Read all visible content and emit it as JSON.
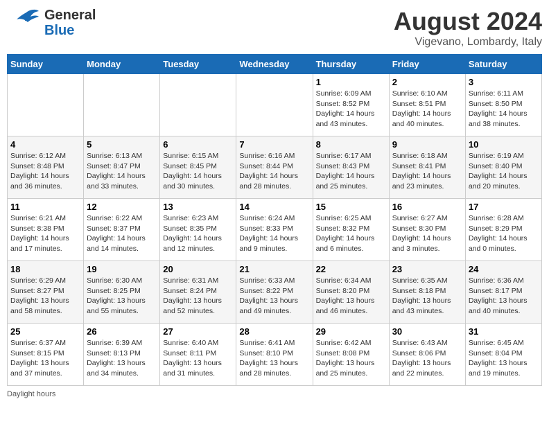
{
  "header": {
    "logo_general": "General",
    "logo_blue": "Blue",
    "month_year": "August 2024",
    "location": "Vigevano, Lombardy, Italy"
  },
  "days_of_week": [
    "Sunday",
    "Monday",
    "Tuesday",
    "Wednesday",
    "Thursday",
    "Friday",
    "Saturday"
  ],
  "weeks": [
    [
      {
        "day": "",
        "info": ""
      },
      {
        "day": "",
        "info": ""
      },
      {
        "day": "",
        "info": ""
      },
      {
        "day": "",
        "info": ""
      },
      {
        "day": "1",
        "info": "Sunrise: 6:09 AM\nSunset: 8:52 PM\nDaylight: 14 hours\nand 43 minutes."
      },
      {
        "day": "2",
        "info": "Sunrise: 6:10 AM\nSunset: 8:51 PM\nDaylight: 14 hours\nand 40 minutes."
      },
      {
        "day": "3",
        "info": "Sunrise: 6:11 AM\nSunset: 8:50 PM\nDaylight: 14 hours\nand 38 minutes."
      }
    ],
    [
      {
        "day": "4",
        "info": "Sunrise: 6:12 AM\nSunset: 8:48 PM\nDaylight: 14 hours\nand 36 minutes."
      },
      {
        "day": "5",
        "info": "Sunrise: 6:13 AM\nSunset: 8:47 PM\nDaylight: 14 hours\nand 33 minutes."
      },
      {
        "day": "6",
        "info": "Sunrise: 6:15 AM\nSunset: 8:45 PM\nDaylight: 14 hours\nand 30 minutes."
      },
      {
        "day": "7",
        "info": "Sunrise: 6:16 AM\nSunset: 8:44 PM\nDaylight: 14 hours\nand 28 minutes."
      },
      {
        "day": "8",
        "info": "Sunrise: 6:17 AM\nSunset: 8:43 PM\nDaylight: 14 hours\nand 25 minutes."
      },
      {
        "day": "9",
        "info": "Sunrise: 6:18 AM\nSunset: 8:41 PM\nDaylight: 14 hours\nand 23 minutes."
      },
      {
        "day": "10",
        "info": "Sunrise: 6:19 AM\nSunset: 8:40 PM\nDaylight: 14 hours\nand 20 minutes."
      }
    ],
    [
      {
        "day": "11",
        "info": "Sunrise: 6:21 AM\nSunset: 8:38 PM\nDaylight: 14 hours\nand 17 minutes."
      },
      {
        "day": "12",
        "info": "Sunrise: 6:22 AM\nSunset: 8:37 PM\nDaylight: 14 hours\nand 14 minutes."
      },
      {
        "day": "13",
        "info": "Sunrise: 6:23 AM\nSunset: 8:35 PM\nDaylight: 14 hours\nand 12 minutes."
      },
      {
        "day": "14",
        "info": "Sunrise: 6:24 AM\nSunset: 8:33 PM\nDaylight: 14 hours\nand 9 minutes."
      },
      {
        "day": "15",
        "info": "Sunrise: 6:25 AM\nSunset: 8:32 PM\nDaylight: 14 hours\nand 6 minutes."
      },
      {
        "day": "16",
        "info": "Sunrise: 6:27 AM\nSunset: 8:30 PM\nDaylight: 14 hours\nand 3 minutes."
      },
      {
        "day": "17",
        "info": "Sunrise: 6:28 AM\nSunset: 8:29 PM\nDaylight: 14 hours\nand 0 minutes."
      }
    ],
    [
      {
        "day": "18",
        "info": "Sunrise: 6:29 AM\nSunset: 8:27 PM\nDaylight: 13 hours\nand 58 minutes."
      },
      {
        "day": "19",
        "info": "Sunrise: 6:30 AM\nSunset: 8:25 PM\nDaylight: 13 hours\nand 55 minutes."
      },
      {
        "day": "20",
        "info": "Sunrise: 6:31 AM\nSunset: 8:24 PM\nDaylight: 13 hours\nand 52 minutes."
      },
      {
        "day": "21",
        "info": "Sunrise: 6:33 AM\nSunset: 8:22 PM\nDaylight: 13 hours\nand 49 minutes."
      },
      {
        "day": "22",
        "info": "Sunrise: 6:34 AM\nSunset: 8:20 PM\nDaylight: 13 hours\nand 46 minutes."
      },
      {
        "day": "23",
        "info": "Sunrise: 6:35 AM\nSunset: 8:18 PM\nDaylight: 13 hours\nand 43 minutes."
      },
      {
        "day": "24",
        "info": "Sunrise: 6:36 AM\nSunset: 8:17 PM\nDaylight: 13 hours\nand 40 minutes."
      }
    ],
    [
      {
        "day": "25",
        "info": "Sunrise: 6:37 AM\nSunset: 8:15 PM\nDaylight: 13 hours\nand 37 minutes."
      },
      {
        "day": "26",
        "info": "Sunrise: 6:39 AM\nSunset: 8:13 PM\nDaylight: 13 hours\nand 34 minutes."
      },
      {
        "day": "27",
        "info": "Sunrise: 6:40 AM\nSunset: 8:11 PM\nDaylight: 13 hours\nand 31 minutes."
      },
      {
        "day": "28",
        "info": "Sunrise: 6:41 AM\nSunset: 8:10 PM\nDaylight: 13 hours\nand 28 minutes."
      },
      {
        "day": "29",
        "info": "Sunrise: 6:42 AM\nSunset: 8:08 PM\nDaylight: 13 hours\nand 25 minutes."
      },
      {
        "day": "30",
        "info": "Sunrise: 6:43 AM\nSunset: 8:06 PM\nDaylight: 13 hours\nand 22 minutes."
      },
      {
        "day": "31",
        "info": "Sunrise: 6:45 AM\nSunset: 8:04 PM\nDaylight: 13 hours\nand 19 minutes."
      }
    ]
  ],
  "footer": {
    "note": "Daylight hours"
  }
}
